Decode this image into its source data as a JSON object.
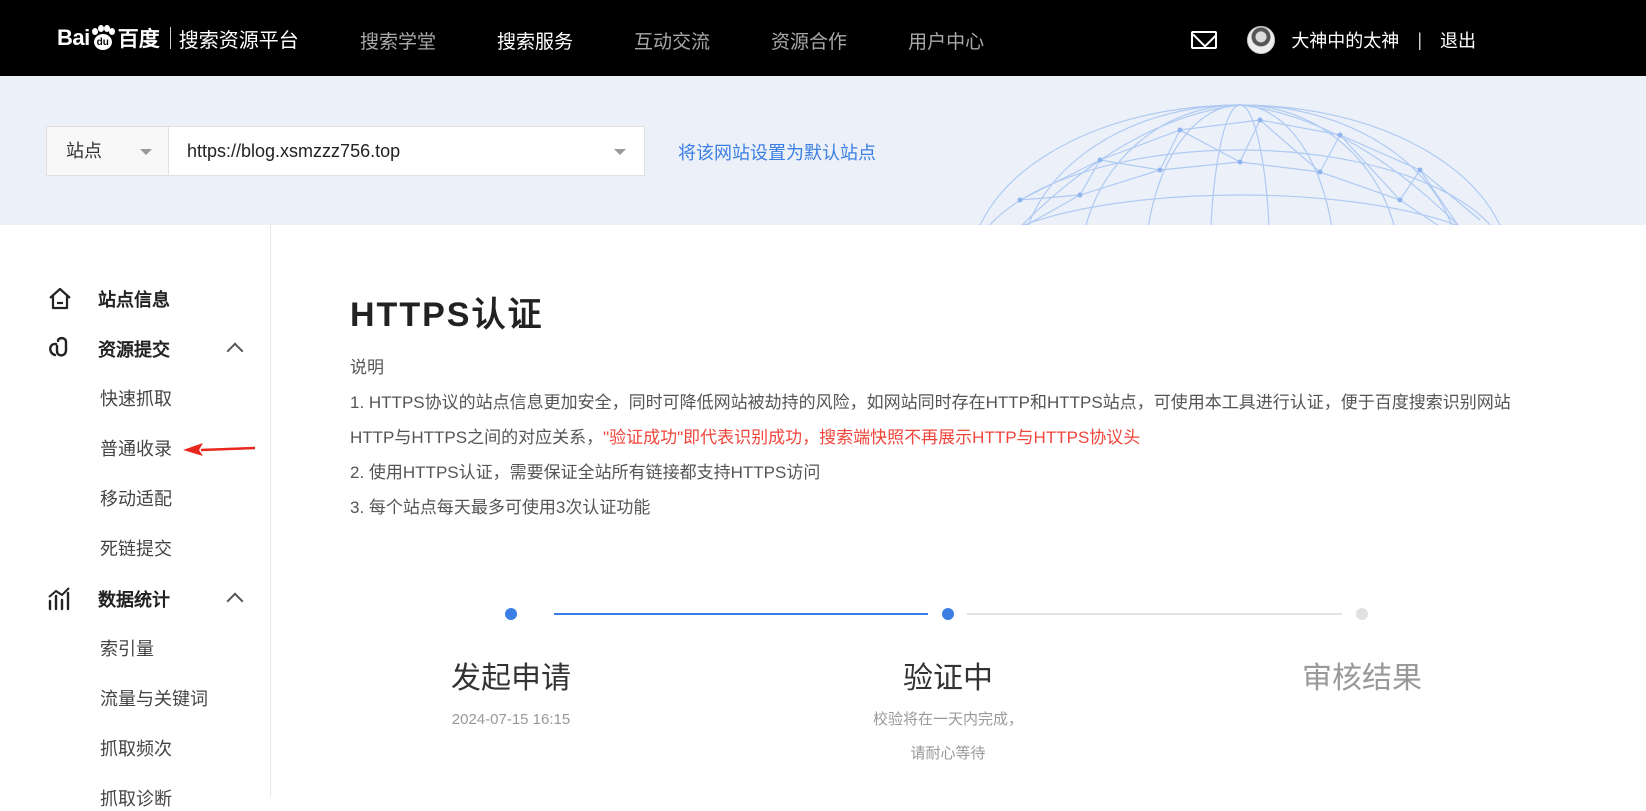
{
  "topbar": {
    "logo_bai": "Bai",
    "logo_du": "du",
    "logo_baidu": "百度",
    "platform": "搜索资源平台",
    "nav": [
      {
        "label": "搜索学堂",
        "active": false
      },
      {
        "label": "搜索服务",
        "active": true
      },
      {
        "label": "互动交流",
        "active": false
      },
      {
        "label": "资源合作",
        "active": false
      },
      {
        "label": "用户中心",
        "active": false
      }
    ],
    "username": "大神中的太神",
    "separator": "|",
    "logout": "退出"
  },
  "banner": {
    "site_type": "站点",
    "site_url": "https://blog.xsmzzz756.top",
    "set_default": "将该网站设置为默认站点"
  },
  "sidebar": {
    "site_info": "站点信息",
    "resource_submit": "资源提交",
    "resource_items": [
      "快速抓取",
      "普通收录",
      "移动适配",
      "死链提交"
    ],
    "data_stats": "数据统计",
    "stats_items": [
      "索引量",
      "流量与关键词",
      "抓取频次",
      "抓取诊断"
    ]
  },
  "main": {
    "title": "HTTPS认证",
    "desc_heading": "说明",
    "desc_line1a": "1. HTTPS协议的站点信息更加安全，同时可降低网站被劫持的风险，如网站同时存在HTTP和HTTPS站点，可使用本工具进行认证，便于百度搜索识别网站",
    "desc_line1b": "HTTP与HTTPS之间的对应关系，",
    "desc_line1_red": "\"验证成功\"即代表识别成功，搜索端快照不再展示HTTP与HTTPS协议头",
    "desc_line2": "2. 使用HTTPS认证，需要保证全站所有链接都支持HTTPS访问",
    "desc_line3": "3. 每个站点每天最多可使用3次认证功能",
    "steps": [
      {
        "title": "发起申请",
        "sub1": "2024-07-15 16:15",
        "sub2": "",
        "state": "done"
      },
      {
        "title": "验证中",
        "sub1": "校验将在一天内完成，",
        "sub2": "请耐心等待",
        "state": "current"
      },
      {
        "title": "审核结果",
        "sub1": "",
        "sub2": "",
        "state": "pending"
      }
    ]
  },
  "colors": {
    "accent": "#3b7ee4",
    "warning": "#f0463c",
    "topbar": "#000000",
    "banner": "#ecf1f9"
  }
}
